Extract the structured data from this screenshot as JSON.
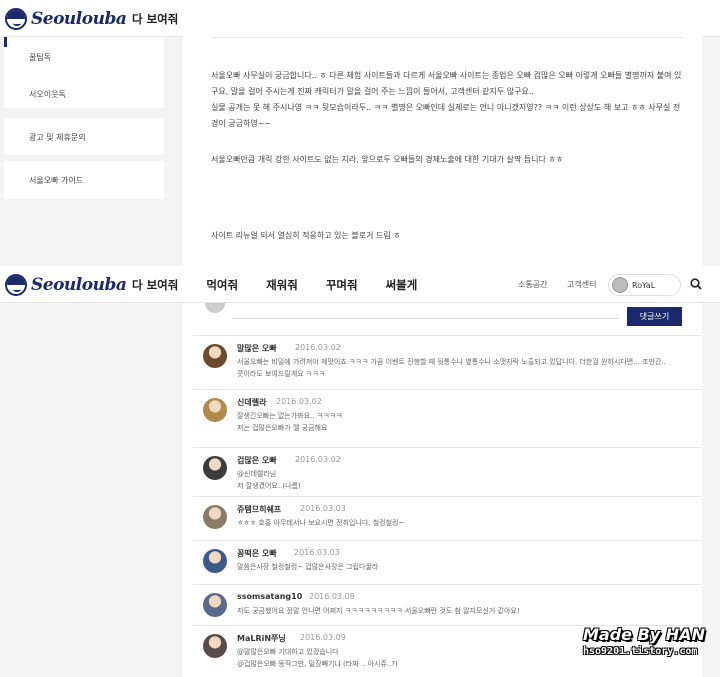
{
  "header": {
    "logo_text": "Seoulouba",
    "nav": [
      "다 보여줘",
      "먹여줘",
      "재워줘",
      "꾸며줘",
      "써볼게"
    ],
    "community": "소통공간",
    "support": "고객센터",
    "user_name": "RoYaL"
  },
  "sidebar": {
    "items": [
      "꿀팁독",
      "서오이웃독",
      "광고 및 제휴문의",
      "서울오빠 가이드"
    ]
  },
  "article": {
    "paragraphs": [
      "서울오빠 사무실이 궁금합니다.. ㅎ 다른 체험 사이트들과 다르게 서울오빠 사이트는 종업은 오빠 겁많은 오빠 이렇게 오빠들 별명까지 붙여 있구요, 말을 걸어 주시는게 진짜 캐릭터가 말을 걸어 주는 느낌이 들어서, 고객센터 같지두 않구요..",
      "실물 공개는 못 해 주시나영 ㅋㅋ 뒷모습이라두.. ㅋㅋ 별명은 오빠인데 실제로는 언니 아니겠지영?? ㅋㅋ 이런 상상도 해 보고 ㅎㅎ 사무실 전경이 궁금하영~~",
      "서울오빠만큼 개릭 강한 사이트도 없는 지라, 앞으로두 오빠들의 경제노출에 대한 기대가 살짝 듭니다 ㅎㅎ",
      "사이트 리뉴얼 되서 열심히 적응하고 있는 블로거 드림 ㅎ"
    ]
  },
  "comments": {
    "submit_label": "댓글쓰기",
    "list": [
      {
        "name": "말많은 오빠",
        "date": "2016.03.02",
        "text": [
          "서울오빠는 비밀에 가려져야 제맛이죠 ㅋㅋㅋ 가끔 이벤트 진행할 때 뒷통수나 옆통수나 소맷자락 노출되고 있답니다. 더한걸 원하시다면... 조만간..",
          "콧이라도 보여드릴게요 ㅋㅋㅋ"
        ],
        "avatar": "#6b4a2e"
      },
      {
        "name": "신데렐라",
        "date": "2016.03.02",
        "text": [
          "잘생긴오빠는 없는가봐요.. ㅋㅋㅋㅋ",
          "저는 겁많은오빠가 젤 궁금해요"
        ],
        "avatar": "#b08a4a"
      },
      {
        "name": "겁많은 오빠",
        "date": "2016.03.02",
        "text": [
          "@신데렐라님",
          "저 잘생겼어요..(나름)"
        ],
        "avatar": "#3b3b3b"
      },
      {
        "name": "쥬템므히쉐프",
        "date": "2016.03.03",
        "text": [
          "ㅎㅎㅎ 호홍 아무데서나 보요시면 정취입니다. 철컹철컹~"
        ],
        "avatar": "#8a7a6a"
      },
      {
        "name": "꽁떡은 오빠",
        "date": "2016.03.03",
        "text": [
          "말씀은사장 철컹철컹~ 겁많은사장은 그립다꿀라"
        ],
        "avatar": "#3a5a8a"
      },
      {
        "name": "ssomsatang10",
        "date": "2016.03.08",
        "text": [
          "저도 궁금했어요 정말 언니면 어쩌지 ㅋㅋㅋㅋㅋㅋㅋㅋㅋ 서울오빠란 것도 참 알지모신거 같아요!"
        ],
        "avatar": "#5a6a8a"
      },
      {
        "name": "MaLRiN쭈닝",
        "date": "2016.03.09",
        "text": [
          "@말많은오빠 기대하고 있겠습니다",
          "@겁많은오빠 동작그만, 밑장빼기냐 (타짜 .. 아시쥬..?)"
        ],
        "avatar": "#5a4a4a"
      }
    ]
  },
  "watermark": {
    "title": "Made By HAN",
    "url": "hso9201.tistory.com"
  }
}
